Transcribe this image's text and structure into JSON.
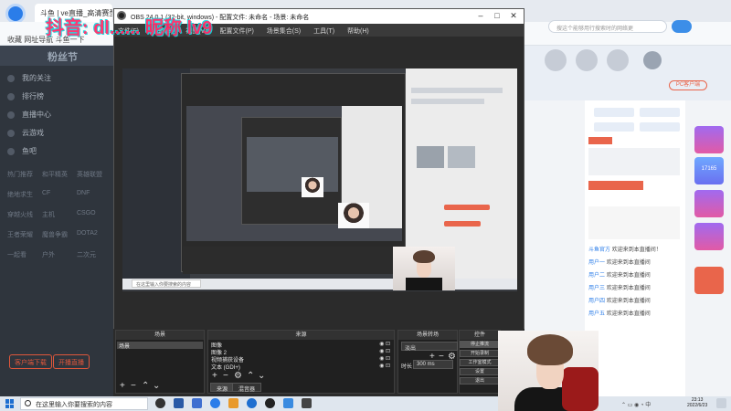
{
  "watermark": "抖音: dl...... 昵称 lv9",
  "browser": {
    "tab_title": "斗鱼 | ve直播_高清赛型视频",
    "bookmarks": "收藏  网址导航  斗鱼一下",
    "search_placeholder": "搜这个能够用行搜索时的网络更"
  },
  "douyu": {
    "banner_text": "粉丝节",
    "nav_items": [
      "我的关注",
      "排行榜",
      "直播中心",
      "云游戏",
      "鱼吧"
    ],
    "categories": [
      [
        "热门推荐",
        "和平精英",
        "英雄联盟"
      ],
      [
        "绝地求生",
        "CF",
        "DNF"
      ],
      [
        "穿越火线",
        "主机",
        "CSGO"
      ],
      [
        "王者荣耀",
        "魔兽争霸",
        "DOTA2"
      ],
      [
        "一起看",
        "户外",
        "二次元"
      ]
    ],
    "bottom_buttons": [
      "客户端下载",
      "开播直播"
    ]
  },
  "obs": {
    "title": "OBS 24.0.1 (32-bit, windows) - 配置文件: 未命名 - 场景: 未命名",
    "menu": [
      "文件(F)",
      "编辑(E)",
      "视图(V)",
      "配置文件(P)",
      "场景集合(S)",
      "工具(T)",
      "帮助(H)"
    ],
    "scenes": {
      "header": "场景",
      "items": [
        "场景"
      ]
    },
    "sources": {
      "header": "来源",
      "items": [
        "图像",
        "图像 2",
        "视频捕获设备",
        "文本 (GDI+)"
      ]
    },
    "transitions": {
      "header": "场景转场",
      "value": "淡出",
      "duration_label": "时长",
      "duration": "300 ms"
    },
    "controls": {
      "header": "控件",
      "buttons": [
        "停止推流",
        "开始录制",
        "工作室模式",
        "设置",
        "退出"
      ]
    },
    "tabs": [
      "来源",
      "混音器"
    ]
  },
  "chat": [
    {
      "user": "斗鱼官方",
      "text": "欢迎来到本直播间！"
    },
    {
      "user": "用户一",
      "text": "欢迎来到本直播间"
    },
    {
      "user": "用户二",
      "text": "欢迎来到本直播间"
    },
    {
      "user": "用户三",
      "text": "欢迎来到本直播间"
    },
    {
      "user": "用户四",
      "text": "欢迎来到本直播间"
    },
    {
      "user": "用户五",
      "text": "欢迎来到本直播间"
    }
  ],
  "right_panel": {
    "pc_button": "PC客户端",
    "gift_label": "17165"
  },
  "taskbar": {
    "search_placeholder": "在这里输入你要搜索的内容",
    "time": "23:13",
    "date": "2022/6/23"
  }
}
